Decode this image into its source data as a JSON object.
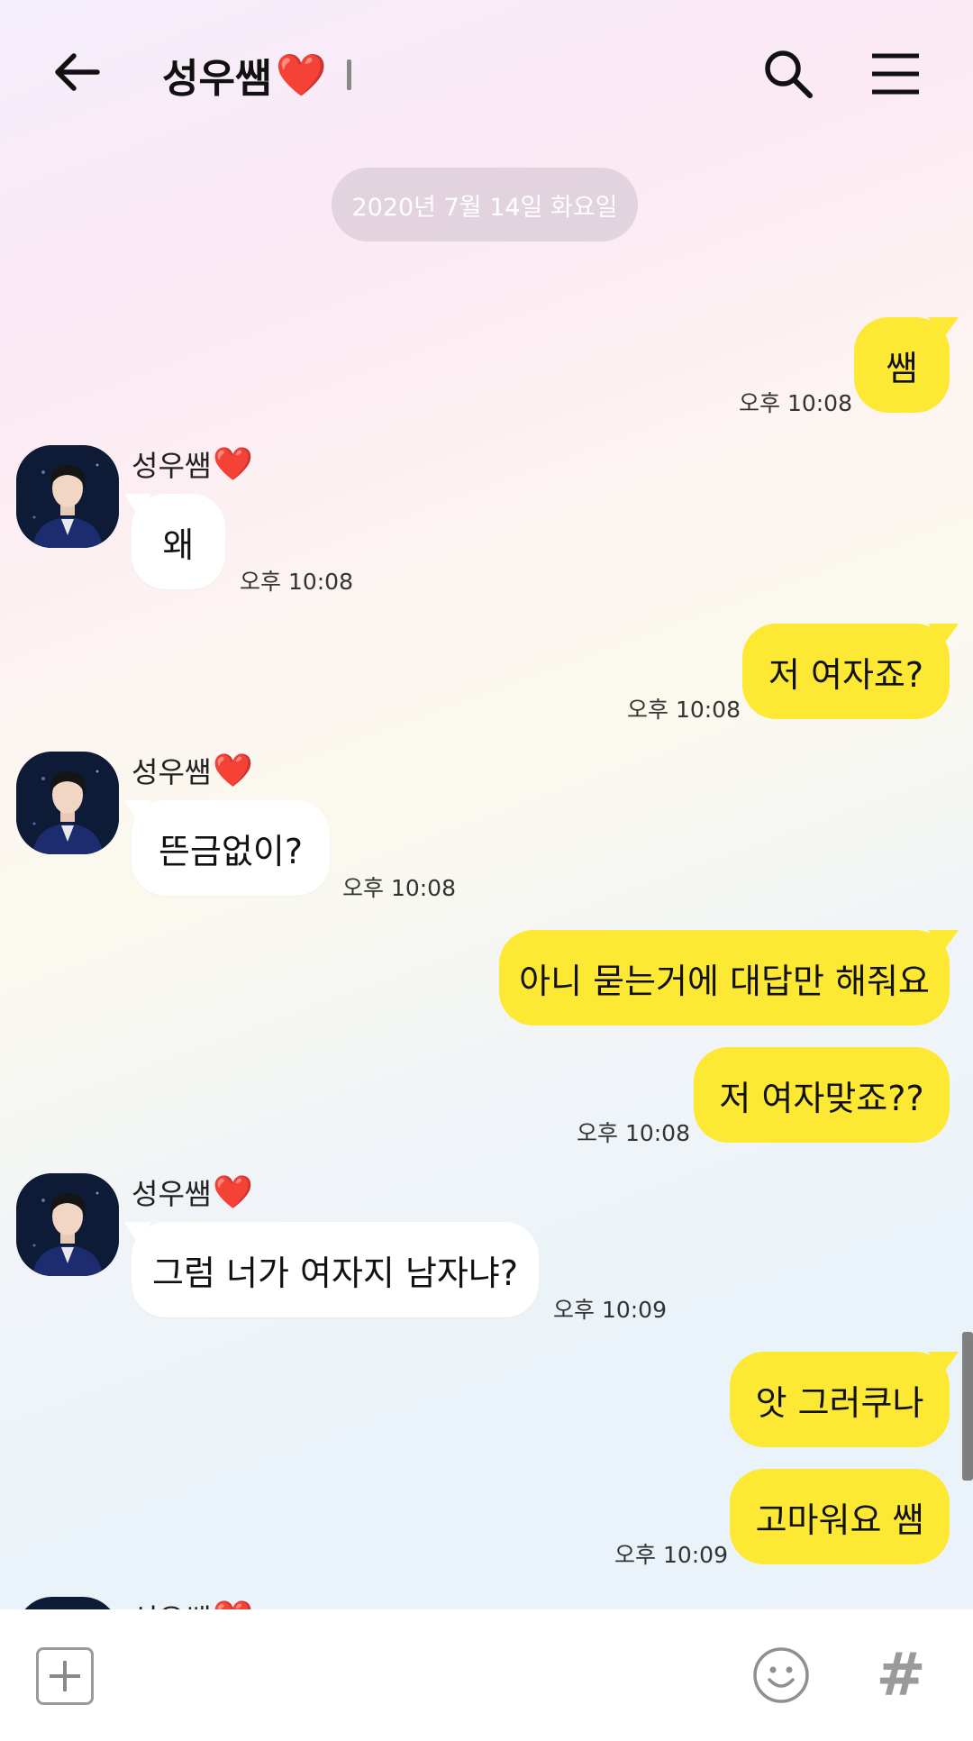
{
  "header": {
    "title": "성우쌤",
    "title_emoji": "❤️",
    "back_icon": "arrow-left-icon",
    "search_icon": "search-icon",
    "menu_icon": "hamburger-menu-icon"
  },
  "date_divider": "2020년 7월 14일 화요일",
  "messages": [
    {
      "from": "me",
      "text": "쌤",
      "time": "오후 10:08"
    },
    {
      "from": "other",
      "sender": "성우쌤",
      "sender_emoji": "❤️",
      "text": "왜",
      "time": "오후 10:08"
    },
    {
      "from": "me",
      "text": "저 여자죠?",
      "time": "오후 10:08"
    },
    {
      "from": "other",
      "sender": "성우쌤",
      "sender_emoji": "❤️",
      "text": "뜬금없이?",
      "time": "오후 10:08"
    },
    {
      "from": "me",
      "text": "아니 묻는거에 대답만 해줘요"
    },
    {
      "from": "me",
      "text": "저 여자맞죠??",
      "time": "오후 10:08"
    },
    {
      "from": "other",
      "sender": "성우쌤",
      "sender_emoji": "❤️",
      "text": "그럼 너가 여자지 남자냐?",
      "time": "오후 10:09"
    },
    {
      "from": "me",
      "text": "앗 그러쿠나"
    },
    {
      "from": "me",
      "text": "고마워요 쌤",
      "time": "오후 10:09"
    }
  ],
  "partial_sender": "성우쌤",
  "bottom_bar": {
    "plus_icon": "plus-square-icon",
    "emoji_icon": "smiley-icon",
    "hash_icon": "#"
  },
  "colors": {
    "my_bubble": "#fde834",
    "other_bubble": "#ffffff",
    "heart": "#e0161f"
  }
}
